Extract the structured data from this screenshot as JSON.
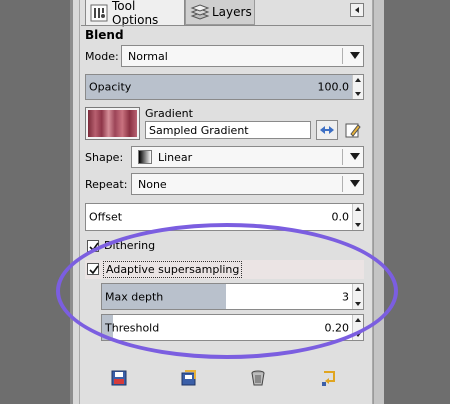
{
  "tabs": [
    {
      "label": "Tool Options",
      "icon": "tool-options-icon"
    },
    {
      "label": "Layers",
      "icon": "layers-icon"
    }
  ],
  "section_title": "Blend",
  "mode": {
    "label": "Mode:",
    "value": "Normal"
  },
  "opacity": {
    "label": "Opacity",
    "value": "100.0",
    "fraction": 1.0
  },
  "gradient": {
    "label": "Gradient",
    "name": "Sampled Gradient"
  },
  "shape": {
    "label": "Shape:",
    "value": "Linear"
  },
  "repeat": {
    "label": "Repeat:",
    "value": "None"
  },
  "offset": {
    "label": "Offset",
    "value": "0.0",
    "fraction": 0.0
  },
  "dithering": {
    "label": "Dithering",
    "checked": true
  },
  "adaptive": {
    "label": "Adaptive supersampling",
    "checked": true
  },
  "max_depth": {
    "label": "Max depth",
    "value": "3",
    "fraction": 0.47
  },
  "threshold": {
    "label": "Threshold",
    "value": "0.20",
    "fraction": 0.05
  },
  "bottom_icons": [
    "save-preset-icon",
    "restore-preset-icon",
    "delete-preset-icon",
    "reset-icon"
  ],
  "colors": {
    "highlight_ring": "#7b5ee0",
    "slider_fill": "#b9c1cc"
  }
}
